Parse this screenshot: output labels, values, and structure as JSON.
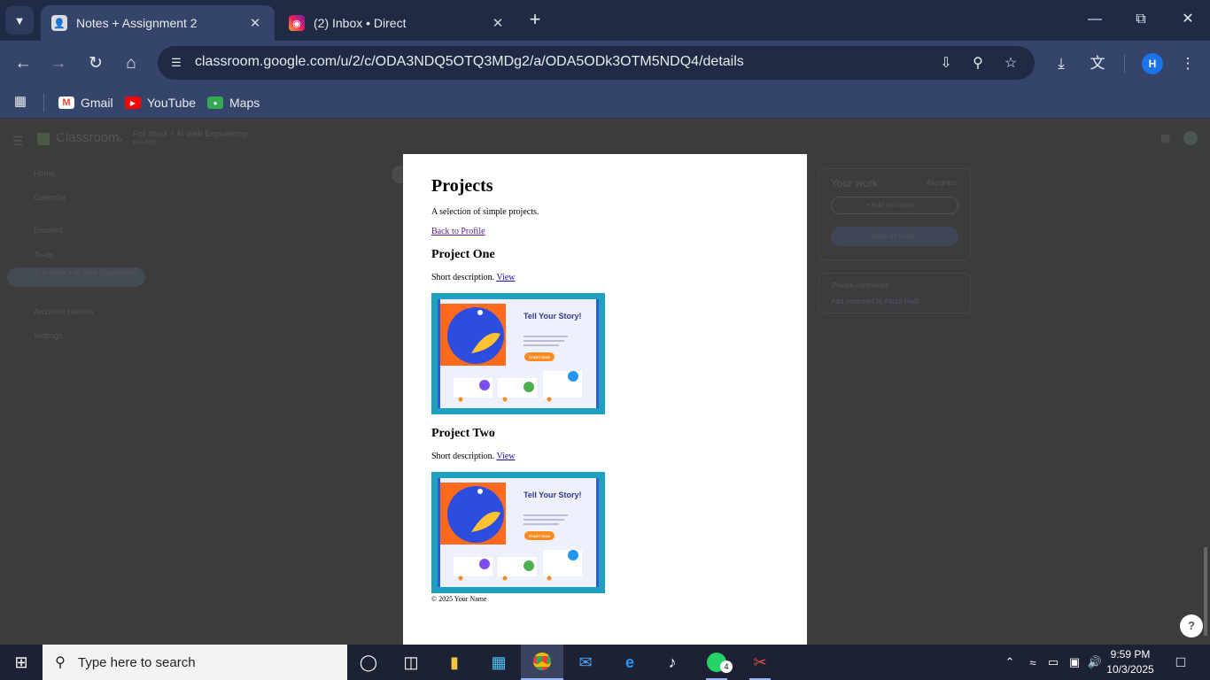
{
  "browser": {
    "tabs": [
      {
        "title": "Notes + Assignment 2",
        "active": true
      },
      {
        "title": "(2) Inbox • Direct",
        "active": false
      }
    ],
    "url": "classroom.google.com/u/2/c/ODA3NDQ5OTQ3MDg2/a/ODA5ODk3OTM5NDQ4/details",
    "profile_initial": "H",
    "bookmarks": [
      {
        "label": "Gmail"
      },
      {
        "label": "YouTube"
      },
      {
        "label": "Maps"
      }
    ]
  },
  "classroom_bg": {
    "app_name": "Classroom",
    "course_title": "Full Stack + AI Web Engineering",
    "course_subtitle": "BEnd 01",
    "sidebar": [
      "Home",
      "Calendar",
      "Enrolled",
      "To-do",
      "Full Stack + AI Web Engineering",
      "Archived classes",
      "Settings"
    ],
    "your_work": "Your work",
    "assigned": "Assigned",
    "add_or_create": "+ Add or create",
    "mark_as_done": "Mark as done",
    "private_comments": "Private comments",
    "add_comment": "Add comment to Abdul Hadi"
  },
  "document": {
    "title": "Projects",
    "tagline": "A selection of simple projects.",
    "back_link": "Back to Profile",
    "projects": [
      {
        "name": "Project One",
        "description": "Short description.",
        "link": "View",
        "image_heading": "Tell Your Story!",
        "image_button": "START NOW"
      },
      {
        "name": "Project Two",
        "description": "Short description.",
        "link": "View",
        "image_heading": "Tell Your Story!",
        "image_button": "START NOW"
      }
    ],
    "footer": "© 2025 Your Name"
  },
  "taskbar": {
    "search_placeholder": "Type here to search",
    "whatsapp_badge": "4",
    "time": "9:59 PM",
    "date": "10/3/2025"
  },
  "colors": {
    "tabbar": "#1f2a44",
    "toolbar": "#35446a",
    "overlay": "#3c3c3c",
    "taskbar": "#1c2233"
  }
}
